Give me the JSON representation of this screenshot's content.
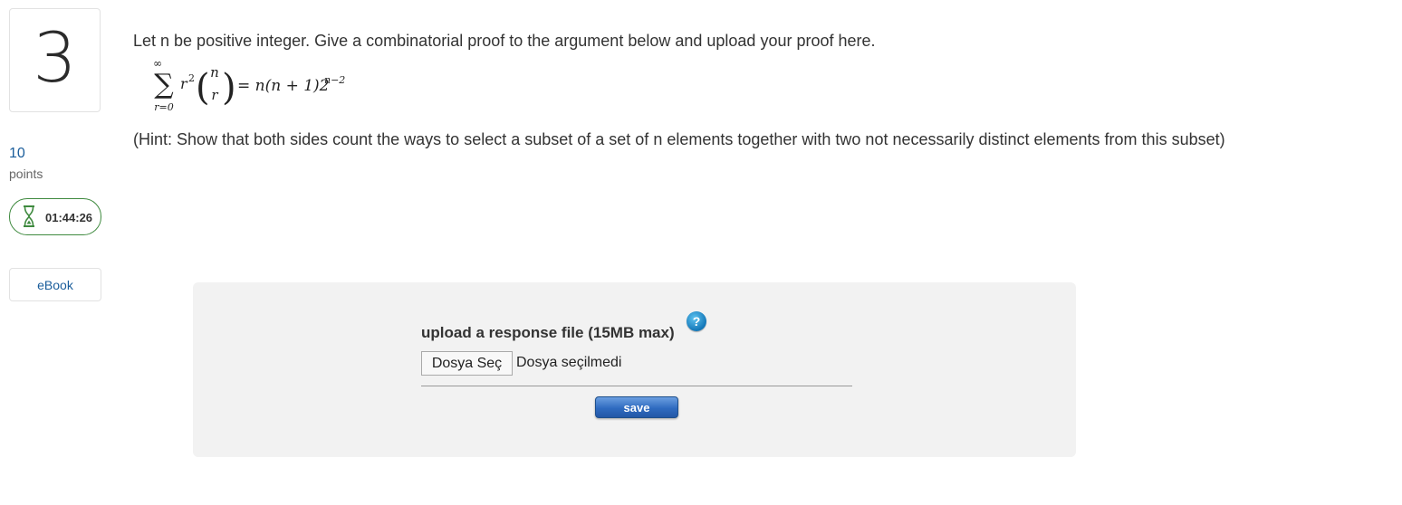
{
  "question": {
    "number": "3",
    "points_value": "10",
    "points_label": "points",
    "timer": "01:44:26",
    "ebook_label": "eBook"
  },
  "content": {
    "prompt": "Let n be positive integer. Give a combinatorial proof to the argument below and upload your proof here.",
    "formula": {
      "sum_upper": "∞",
      "sum_lower": "r=0",
      "term": "r",
      "term_exp": "2",
      "binom_top": "n",
      "binom_bottom": "r",
      "rhs": "= n(n + 1)2",
      "rhs_exp": "n−2"
    },
    "hint": "(Hint: Show that both sides count the ways to select a subset of a set of n elements together with two not necessarily distinct elements from this subset)"
  },
  "upload": {
    "label": "upload a response file (15MB max)",
    "help_glyph": "?",
    "choose_button": "Dosya Seç",
    "file_status": "Dosya seçilmedi",
    "save_button": "save"
  },
  "colors": {
    "accent_blue": "#1a5d9b",
    "timer_green": "#3f8a3f",
    "panel_bg": "#f2f2f2"
  }
}
